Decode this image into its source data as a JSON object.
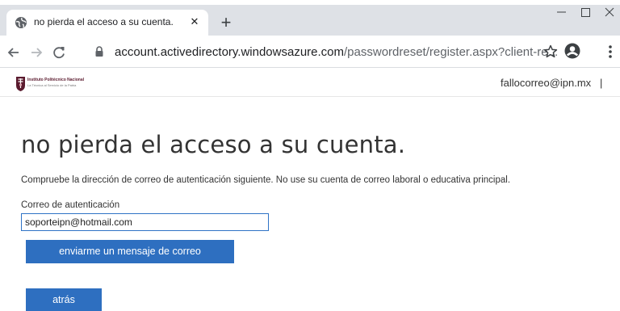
{
  "browser": {
    "tab": {
      "title": "no pierda el acceso a su cuenta.",
      "close_glyph": "✕",
      "favicon": "globe-icon"
    },
    "new_tab_glyph": "+",
    "address": {
      "domain": "account.activedirectory.windowsazure.com",
      "path": "/passwordreset/register.aspx?client-re..."
    },
    "icons": {
      "back": "arrow-left-icon",
      "forward": "arrow-right-icon",
      "reload": "reload-icon",
      "lock": "lock-icon",
      "bookmark": "star-icon",
      "profile": "profile-icon",
      "menu": "kebab-menu-icon"
    }
  },
  "header": {
    "logo_title": "Instituto Politécnico Nacional",
    "logo_subtitle": "La Técnica al Servicio de la Patria",
    "user_email": "fallocorreo@ipn.mx",
    "separator": "|"
  },
  "main": {
    "title": "no pierda el acceso a su cuenta.",
    "instructions": "Compruebe la dirección de correo de autenticación siguiente. No use su cuenta de correo laboral o educativa principal.",
    "email_label": "Correo de autenticación",
    "email_value": "soporteipn@hotmail.com",
    "send_button": "enviarme un mensaje de correo",
    "back_button": "atrás"
  },
  "colors": {
    "accent": "#2e6fc0",
    "input_border": "#2f73c6",
    "tabstrip": "#dee1e6",
    "logo": "#5a1a2e"
  }
}
